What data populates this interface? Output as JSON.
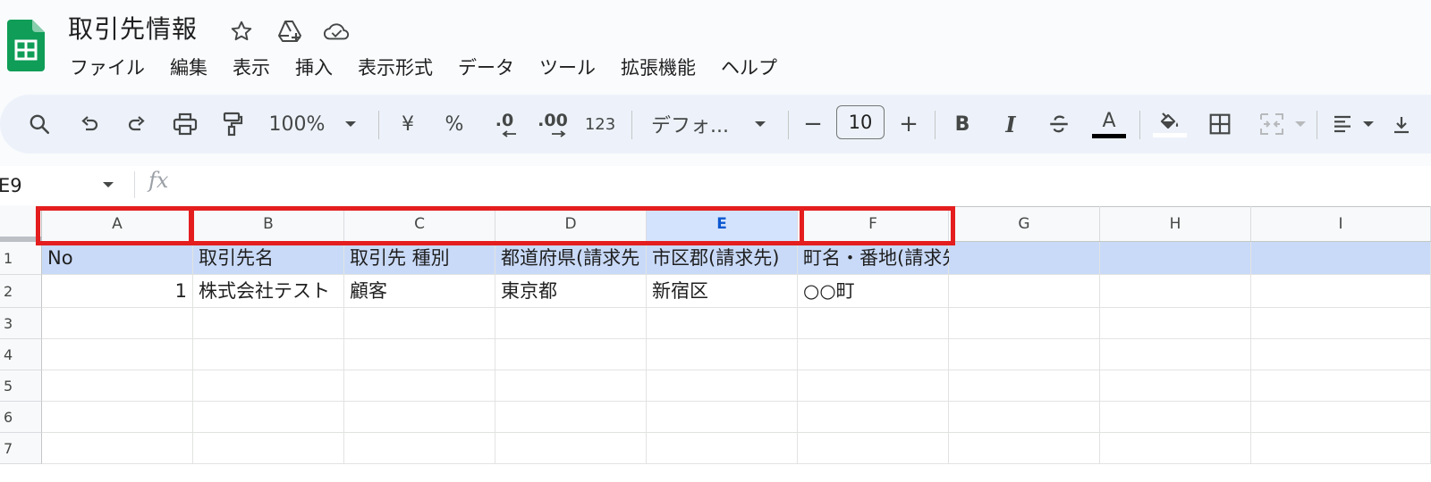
{
  "app": {
    "doc_title": "取引先情報",
    "brand_color": "#0f9d58"
  },
  "menu": [
    "ファイル",
    "編集",
    "表示",
    "挿入",
    "表示形式",
    "データ",
    "ツール",
    "拡張機能",
    "ヘルプ"
  ],
  "toolbar": {
    "zoom": "100%",
    "currency": "¥",
    "percent": "%",
    "decrease_decimal": ".0",
    "increase_decimal": ".00",
    "number_format": "123",
    "font": "デフォ...",
    "font_size": "10",
    "minus": "−",
    "plus": "+",
    "bold": "B",
    "italic": "I",
    "text_color_letter": "A"
  },
  "formula_bar": {
    "name_box": "E9",
    "fx": "fx"
  },
  "grid": {
    "columns": [
      "A",
      "B",
      "C",
      "D",
      "E",
      "F",
      "G",
      "H",
      "I"
    ],
    "selected_column": "E",
    "rows": [
      "1",
      "2",
      "3",
      "4",
      "5",
      "6",
      "7"
    ],
    "header_row": [
      "No",
      "取引先名",
      "取引先 種別",
      "都道府県(請求先",
      "市区郡(請求先)",
      "町名・番地(請求先)",
      "",
      "",
      ""
    ],
    "data_row": [
      "1",
      "株式会社テスト",
      "顧客",
      "東京都",
      "新宿区",
      "○○町",
      "",
      "",
      ""
    ],
    "header_fill": "#c9daf8"
  },
  "annotation": {
    "highlight_color": "#e41e1e"
  }
}
